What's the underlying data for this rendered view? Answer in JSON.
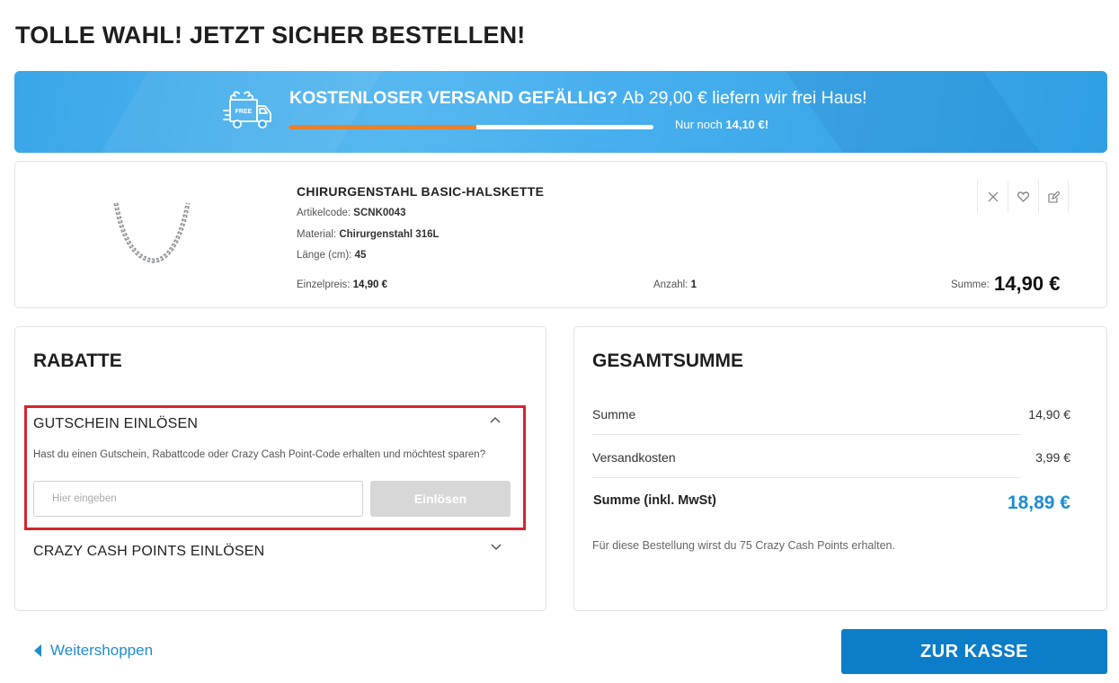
{
  "page_title": "TOLLE WAHL! JETZT SICHER BESTELLEN!",
  "shipping_banner": {
    "icon": "free-shipping-truck-icon",
    "truck_badge": "FREE",
    "headline_strong": "KOSTENLOSER VERSAND GEFÄLLIG?",
    "headline_rest": "Ab 29,00 € liefern wir frei Haus!",
    "remaining_prefix": "Nur noch",
    "remaining_amount": "14,10 €!",
    "progress_percent": 51.4,
    "progress_color": "#e4822f"
  },
  "cart_item": {
    "name": "CHIRURGENSTAHL BASIC-HALSKETTE",
    "article_code_label": "Artikelcode:",
    "article_code": "SCNK0043",
    "material_label": "Material:",
    "material": "Chirurgenstahl 316L",
    "length_label": "Länge (cm):",
    "length": "45",
    "unit_price_label": "Einzelpreis:",
    "unit_price": "14,90 €",
    "quantity_label": "Anzahl:",
    "quantity": "1",
    "sum_label": "Summe:",
    "sum": "14,90 €",
    "actions": [
      "close-icon",
      "heart-icon",
      "edit-icon"
    ]
  },
  "discounts": {
    "title": "RABATTE",
    "voucher": {
      "title": "GUTSCHEIN EINLÖSEN",
      "description": "Hast du einen Gutschein, Rabattcode oder Crazy Cash Point-Code erhalten und möchtest sparen?",
      "input_placeholder": "Hier eingeben",
      "input_value": "",
      "button_label": "Einlösen",
      "expanded": true
    },
    "cash_points": {
      "title": "CRAZY CASH POINTS EINLÖSEN",
      "expanded": false
    },
    "highlight_color": "#d9232d"
  },
  "totals": {
    "title": "GESAMTSUMME",
    "subtotal_label": "Summe",
    "subtotal": "14,90 €",
    "shipping_label": "Versandkosten",
    "shipping": "3,99 €",
    "grand_total_label": "Summe (inkl. MwSt)",
    "grand_total": "18,89 €",
    "points_note": "Für diese Bestellung wirst du 75 Crazy Cash Points erhalten."
  },
  "footer": {
    "back_label": "Weitershoppen",
    "checkout_label": "ZUR KASSE"
  },
  "colors": {
    "accent": "#1e8cd2",
    "checkout": "#0c7dc8",
    "banner": "#47afee"
  }
}
